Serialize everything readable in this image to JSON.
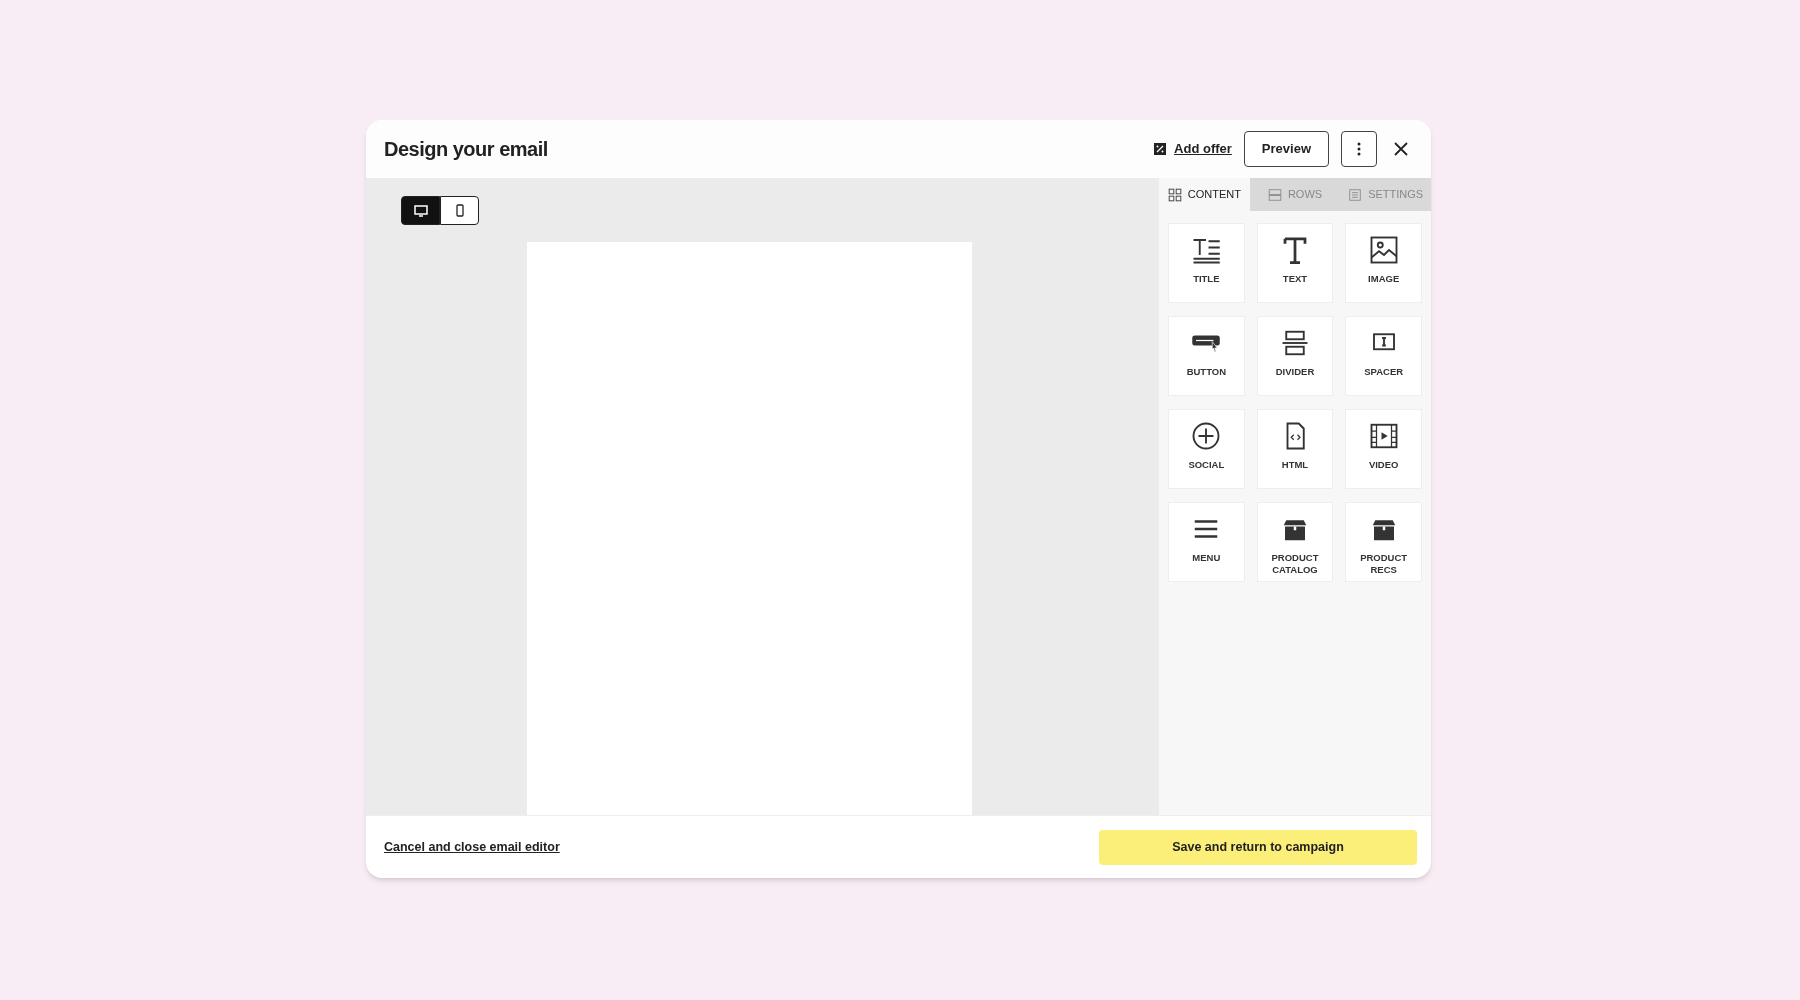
{
  "dialog": {
    "title": "Design your email",
    "add_offer": "Add offer",
    "preview": "Preview"
  },
  "devices": [
    {
      "kind": "desktop",
      "selected": true
    },
    {
      "kind": "mobile",
      "selected": false
    }
  ],
  "tabs": [
    {
      "kind": "content",
      "label": "CONTENT",
      "selected": true
    },
    {
      "kind": "rows",
      "label": "ROWS",
      "selected": false
    },
    {
      "kind": "settings",
      "label": "SETTINGS",
      "selected": false
    }
  ],
  "blocks": [
    {
      "kind": "title",
      "label": "TITLE"
    },
    {
      "kind": "text",
      "label": "TEXT"
    },
    {
      "kind": "image",
      "label": "IMAGE"
    },
    {
      "kind": "button",
      "label": "BUTTON"
    },
    {
      "kind": "divider",
      "label": "DIVIDER"
    },
    {
      "kind": "spacer",
      "label": "SPACER"
    },
    {
      "kind": "social",
      "label": "SOCIAL"
    },
    {
      "kind": "html",
      "label": "HTML"
    },
    {
      "kind": "video",
      "label": "VIDEO"
    },
    {
      "kind": "menu",
      "label": "MENU"
    },
    {
      "kind": "box",
      "label": "PRODUCT CATALOG"
    },
    {
      "kind": "box",
      "label": "PRODUCT RECS"
    }
  ],
  "footer": {
    "cancel": "Cancel and close email editor",
    "save": "Save and return to campaign"
  }
}
